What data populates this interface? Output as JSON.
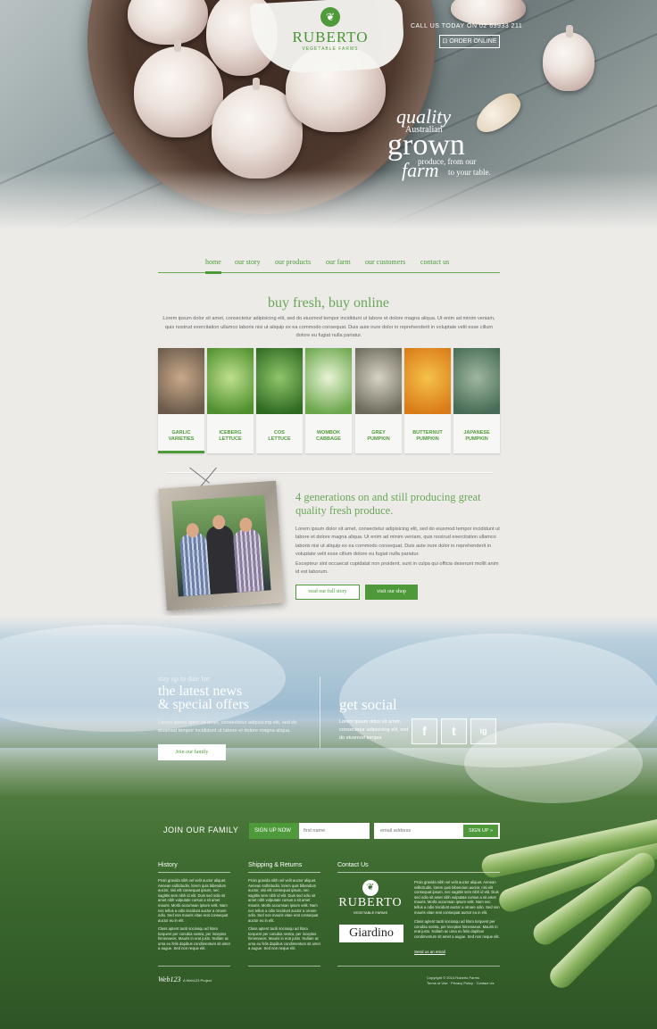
{
  "brand": {
    "name": "RUBERTO",
    "sub": "VEGETABLE FARMS"
  },
  "header": {
    "call_text": "CALL US TODAY ON 02 69933 211",
    "order_label": "ORDER ONLINE",
    "tagline": {
      "quality": "quality",
      "australian": "Australian",
      "grown": "grown",
      "produce": "produce, from our",
      "farm": "farm",
      "table": "to your table."
    }
  },
  "nav": {
    "items": [
      "home",
      "our story",
      "our products",
      "our farm",
      "our customers",
      "contact us"
    ],
    "active": "home"
  },
  "buy": {
    "title": "buy fresh, buy online",
    "text": "Lorem ipsum dolor sit amet, consectetur adipisicing elit, sed do eiusmod tempor incididunt ut labore et dolore magna aliqua. Ut enim ad minim veniam, quis nostrud exercitation ullamco laboris nisi ut aliquip ex ea commodo consequat. Duis aute irure dolor in reprehenderit in voluptate velit esse cillum dolore eu fugiat nulla pariatur."
  },
  "products": [
    {
      "line1": "GARLIC",
      "line2": "VARIETIES",
      "c1": "#c9a98a",
      "c2": "#6a5a4a"
    },
    {
      "line1": "ICEBERG",
      "line2": "LETTUCE",
      "c1": "#bfe08e",
      "c2": "#4f8f2e"
    },
    {
      "line1": "COS",
      "line2": "LETTUCE",
      "c1": "#8fc66a",
      "c2": "#2f6a22"
    },
    {
      "line1": "WOMBOK",
      "line2": "CABBAGE",
      "c1": "#e9f4d6",
      "c2": "#6aa64a"
    },
    {
      "line1": "GREY",
      "line2": "PUMPKIN",
      "c1": "#d8d3c4",
      "c2": "#6b6a5a"
    },
    {
      "line1": "BUTTERNUT",
      "line2": "PUMPKIN",
      "c1": "#f6c24a",
      "c2": "#d97b17"
    },
    {
      "line1": "JAPANESE",
      "line2": "PUMPKIN",
      "c1": "#9fb7a0",
      "c2": "#476b55"
    }
  ],
  "story": {
    "title": "4 generations on and still producing great quality fresh produce.",
    "text1": "Lorem ipsum dolor sit amet, consectetur adipisicing elit, sed do eiusmod tempor incididunt ut labore et dolore magna aliqua. Ut enim ad minim veniam, quis nostrud exercitation ullamco laboris nisi ut aliquip ex ea commodo consequat. Duis aute irure dolor in reprehenderit in voluptate velit esse cillum dolore eu fugiat nulla pariatur.",
    "text2": "Excepteur sint occaecat cupidatat non proident, sunt in culpa qui officia deserunt mollit anim id est laborum.",
    "btn_story": "read our full story",
    "btn_shop": "visit our shop"
  },
  "news": {
    "small": "stay up to date for",
    "h1": "the latest news",
    "h2": "& special offers",
    "text": "Lorem ipsum dolor sit amet, consectetur adipisicing elit, sed do eiusmod tempor incididunt ut labore et dolore magna aliqua.",
    "btn": "Join our family"
  },
  "social": {
    "title": "get social",
    "text": "Lorem ipsum dolor sit amet, consectetur adipisicing elit, sed do eiusmod tempor",
    "icons": [
      "f",
      "t",
      "ig"
    ]
  },
  "signup": {
    "label": "JOIN OUR FAMILY",
    "tag": "SIGN UP NOW",
    "first_placeholder": "first name",
    "email_placeholder": "email address",
    "btn": "SIGN UP »"
  },
  "footer": {
    "col1_title": "History",
    "col2_title": "Shipping & Returns",
    "col3_title": "Contact Us",
    "col1_text": "Proin gravida nibh vel velit auctor aliquet. Aenean sollicitudin, lorem quis bibendum auctor, nisi elit consequat ipsum, nec sagittis sem nibh id elit. Duis sed odio sit amet nibh vulputate cursus a sit amet mauris. Morbi accumsan ipsum velit. Nam nec tellus a odio tincidunt auctor a ornare odio. Sed non mauris vitae erat consequat auctor eu in elit.",
    "col1_text2": "Class aptent taciti sociosqu ad litora torquent per conubia nostra, per inceptos himenaeos. Mauris in erat justo. Nullam ac urna eu felis dapibus condimentum sit amet a augue. Sed non neque elit.",
    "col2_text": "Proin gravida nibh vel velit auctor aliquet. Aenean sollicitudin, lorem quis bibendum auctor, nisi elit consequat ipsum, nec sagittis sem nibh id elit. Duis sed odio sit amet nibh vulputate cursus a sit amet mauris. Morbi accumsan ipsum velit. Nam nec tellus a odio tincidunt auctor a ornare odio. Sed non mauris vitae erat consequat auctor eu in elit.",
    "col2_text2": "Class aptent taciti sociosqu ad litora torquent per conubia nostra, per inceptos himenaeos. Mauris in erat justo. Nullam ac urna eu felis dapibus condimentum sit amet a augue. Sed non neque elit.",
    "col3_text": "Proin gravida nibh vel velit auctor aliquet. Aenean sollicitudin, lorem quis bibendum auctor, nisi elit consequat ipsum, nec sagittis sem nibh id elit. Duis sed odio sit amet nibh vulputate cursus a sit amet mauris. Morbi accumsan ipsum velit. Nam nec tellus a odio tincidunt auctor a ornare odio. Sed non mauris vitae erat consequat auctor eu in elit.",
    "col3_text2": "Class aptent taciti sociosqu ad litora torquent per conubia nostra, per inceptos himenaeos. Mauris in erat justo. Nullam ac urna eu felis dapibus condimentum sit amet a augue. Sed non neque elit.",
    "giardino": "Giardino",
    "signup_link": "Send us an email",
    "w3": "Web123",
    "w3_sub": "A Web123 Project",
    "copyright": "Copyright © 2014 Ruberto Farms",
    "terms": "Terms of Use · Privacy Policy · Contact Us"
  }
}
